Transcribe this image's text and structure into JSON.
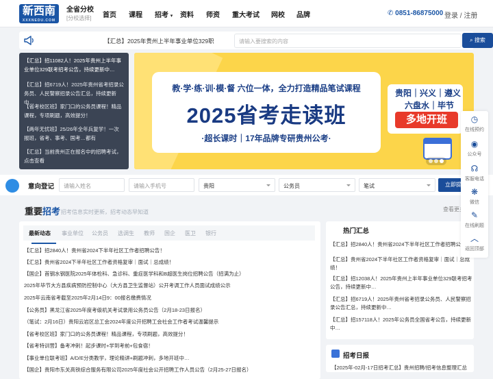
{
  "header": {
    "logo_text": "新西南",
    "logo_sub": "XXXNEDU.COM",
    "branch_title": "全省分校",
    "branch_sub": "[分校选择]",
    "nav": [
      "首页",
      "课程",
      "招考",
      "资料",
      "师资",
      "重大考试",
      "网校",
      "品牌"
    ],
    "phone": "0851-86875000",
    "login": "登录 / 注册"
  },
  "searchbar": {
    "ticker": "【汇总】2025年贵州上半年事业单位329职",
    "placeholder": "请输入要搜索的内容",
    "button": "搜索"
  },
  "news_list": [
    "【汇总】招11082人！2025年贵州上半年事业单位329联考招考公告，持续更新中…",
    "【汇总】招6719人！2025年贵州省考招录公务员、人民警察招录公告汇总，持续更新中…",
    "【省考校区班】家门口的公务员课程！精品课程，专项刷题，高效提分！",
    "【两年无忧班】25/26年全年兵复学！一次报班，省考、事考、国考…都有",
    "【汇总】当前贵州正在报名中的招聘考试，点击查看"
  ],
  "banner": {
    "top_line": "教·学·练·训·模·督 六位一体，全力打造精品笔试课程",
    "main_title": "2025省考走读班",
    "sub_line": "·超长课时｜17年品牌专研贵州公考·",
    "cities": [
      "贵阳｜兴义｜遵义",
      "六盘水｜毕节"
    ],
    "badge": "多地开班",
    "active_slide": 3,
    "total_slides": 3
  },
  "registration": {
    "label": "意向登记",
    "name_placeholder": "请输入姓名",
    "phone_placeholder": "请输入手机号",
    "city": "贵阳",
    "category": "公务员",
    "exam": "笔试",
    "button": "立即提交"
  },
  "section": {
    "title_a": "重要",
    "title_b": "招考",
    "subtitle": "招考信息实时更新，招考动态早知道",
    "more": "查看更多"
  },
  "tabs": [
    "最新动态",
    "事业单位",
    "公务员",
    "选调生",
    "教师",
    "国企",
    "医卫",
    "银行"
  ],
  "articles": [
    "【汇总】招2840人！贵州省2024下半年社区工作者招聘公告！",
    "【汇总】贵州省2024下半年社区工作者资格复审｜面试｜总成绩！",
    "【国企】首钢水钢医院2025年体检科、急诊科、重症医学科和B超医生岗位招聘公告（招满为止）",
    "2025年毕节大方县疾病预防控制中心（大方县卫生监督站）公开考调工作人员面试成绩公示",
    "2025年云南省考截至2025年2月14日9：00报名缴费情况",
    "【公务员】黑龙江省2025年度考级机关考试录用公务员公告（2月18-23日报名）",
    "（笔试：2月16日）贵阳云岩区总工会2024年度公开招聘工会社会工作者考试温馨提示",
    "【省考校区班】家门口的公务员课程！精品课程，专项刷题，高效提分！",
    "【省考特训营】备考冲刺！起步课时+学到考前+包食宿！",
    "【事业单位联考班】A/D/E分类教学，理论精讲+刷题冲刺，多地开班中…",
    "【国企】贵阳市东关高铁综合服务有限公司2025年度社会公开招聘工作人员公告（2月25-27日报名）"
  ],
  "hot": {
    "title": "热门汇总",
    "items": [
      "【汇总】招2840人！贵州省2024下半年社区工作者招聘公告！",
      "【汇总】贵州省2024下半年社区工作者资格复审｜面试｜总成绩！",
      "【汇总】招12038人！2025年贵州上半年事业单位329联考招考公告，持续更新中…",
      "【汇总】招6719人！2025年贵州省考招录公务员、人民警察招录公告汇总，持续更新中…",
      "【汇总】招157118人！2025年公务员全国省考公告，持续更新中…"
    ]
  },
  "calendar": {
    "title": "招考日报",
    "item": "【2025年-02月-17日招考汇总】贵州招聘/招考信息整理汇总"
  },
  "side_tools": [
    "在线预约",
    "公众号",
    "客服电话",
    "微信",
    "在线刷题",
    "返回顶部"
  ]
}
